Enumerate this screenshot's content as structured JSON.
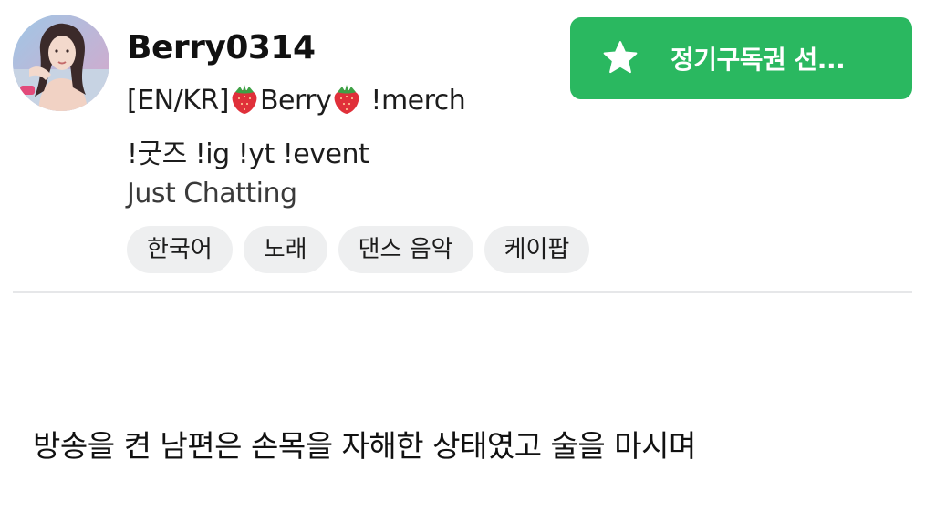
{
  "channel": {
    "name": "Berry0314",
    "title_line1_prefix": "[EN/KR]",
    "title_line1_name": "Berry",
    "title_line1_suffix": " !merch",
    "title_line2": "!굿즈 !ig !yt !event",
    "category": "Just Chatting",
    "tags": [
      "한국어",
      "노래",
      "댄스 음악",
      "케이팝"
    ]
  },
  "subscribe_button": {
    "label": "정기구독권 선...",
    "icon": "star-icon",
    "color": "#2ab860"
  },
  "caption": "방송을 켠 남편은 손목을 자해한 상태였고 술을 마시며",
  "icons": {
    "title_emoji": "strawberry-icon"
  }
}
